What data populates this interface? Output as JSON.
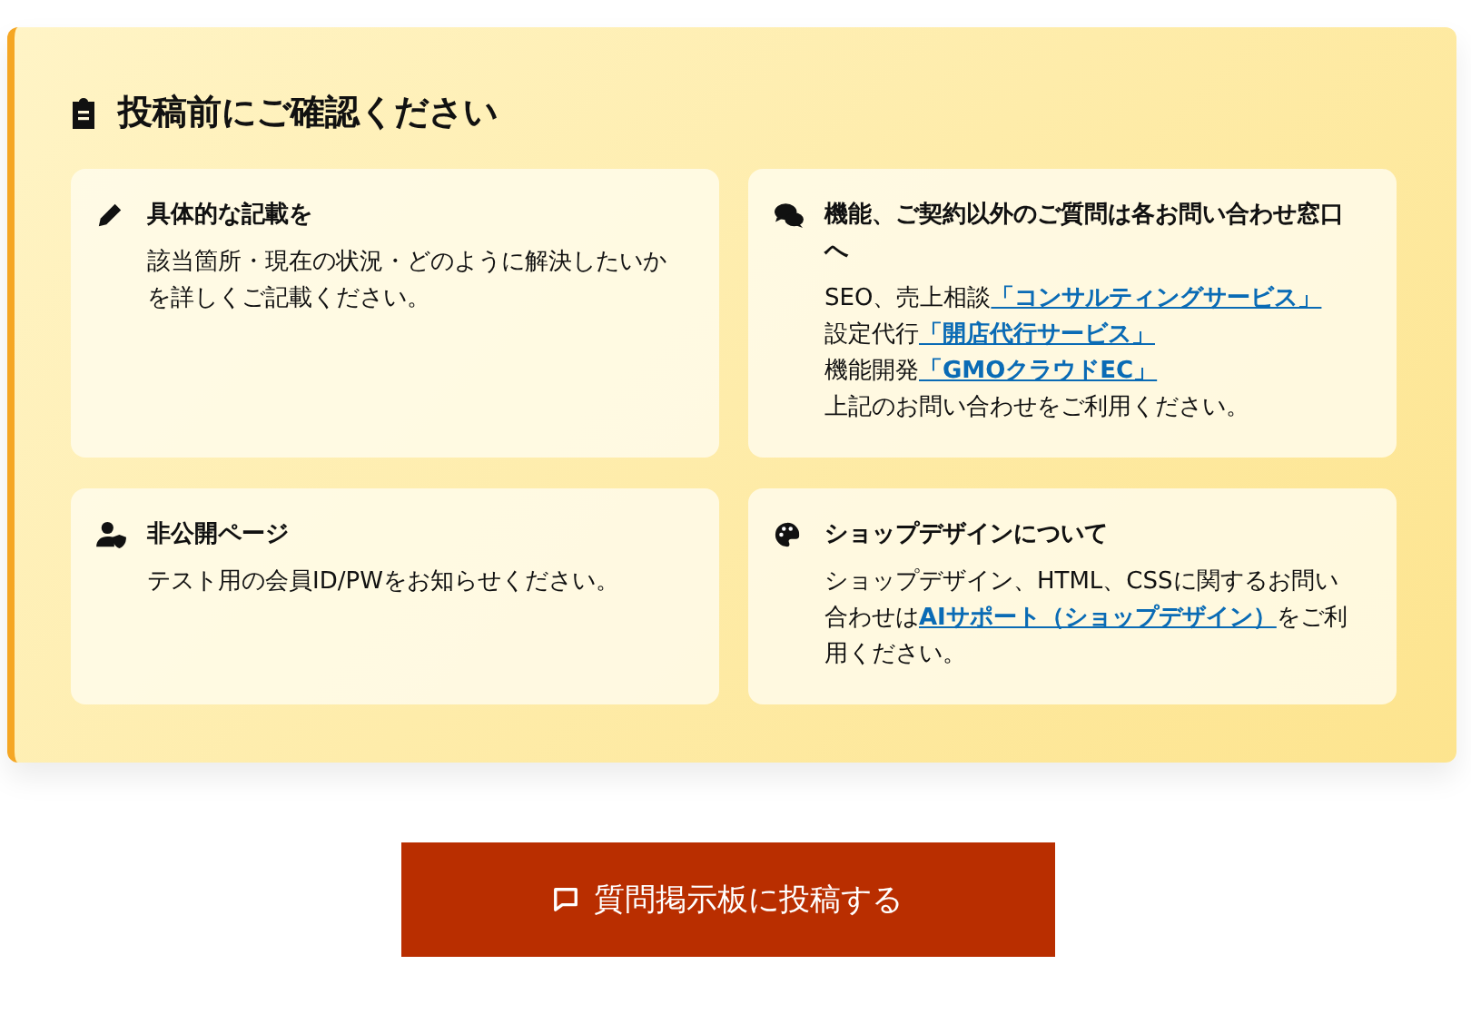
{
  "notice": {
    "title": "投稿前にご確認ください",
    "cards": [
      {
        "heading": "具体的な記載を",
        "paragraphs": [
          [
            {
              "kind": "text",
              "text": "該当箇所・現在の状況・どのように解決したいかを詳しくご記載ください。"
            }
          ]
        ]
      },
      {
        "heading": "機能、ご契約以外のご質問は各お問い合わせ窓口へ",
        "paragraphs": [
          [
            {
              "kind": "text",
              "text": "SEO、売上相談"
            },
            {
              "kind": "link",
              "text": "「コンサルティングサービス」"
            }
          ],
          [
            {
              "kind": "text",
              "text": "設定代行"
            },
            {
              "kind": "link",
              "text": "「開店代行サービス」"
            }
          ],
          [
            {
              "kind": "text",
              "text": "機能開発"
            },
            {
              "kind": "link",
              "text": "「GMOクラウドEC」"
            }
          ],
          [
            {
              "kind": "text",
              "text": "上記のお問い合わせをご利用ください。"
            }
          ]
        ]
      },
      {
        "heading": "非公開ページ",
        "paragraphs": [
          [
            {
              "kind": "text",
              "text": "テスト用の会員ID/PWをお知らせください。"
            }
          ]
        ]
      },
      {
        "heading": "ショップデザインについて",
        "paragraphs": [
          [
            {
              "kind": "text",
              "text": "ショップデザイン、HTML、CSSに関するお問い合わせは"
            },
            {
              "kind": "link",
              "text": "AIサポート（ショップデザイン）"
            },
            {
              "kind": "text",
              "text": "をご利用ください。"
            }
          ]
        ]
      }
    ]
  },
  "submit_button": {
    "label": "質問掲示板に投稿する"
  }
}
